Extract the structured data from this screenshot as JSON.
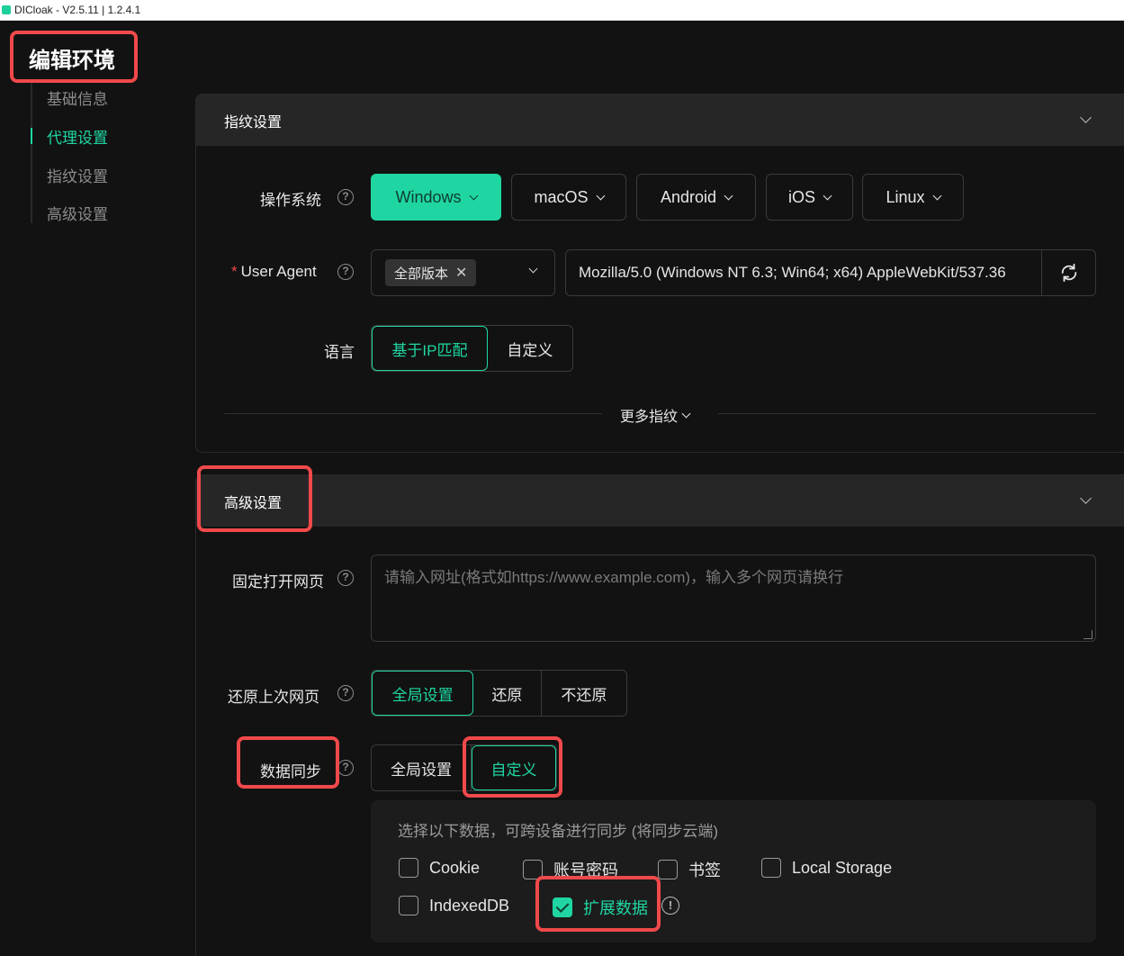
{
  "window": {
    "title": "DICloak - V2.5.11 | 1.2.4.1"
  },
  "page": {
    "title": "编辑环境"
  },
  "sidebar": {
    "items": [
      {
        "label": "基础信息"
      },
      {
        "label": "代理设置"
      },
      {
        "label": "指纹设置"
      },
      {
        "label": "高级设置"
      }
    ],
    "active_index": 1
  },
  "fingerprint": {
    "title": "指纹设置",
    "os_label": "操作系统",
    "os_options": [
      "Windows",
      "macOS",
      "Android",
      "iOS",
      "Linux"
    ],
    "os_selected": "Windows",
    "ua_label": "User Agent",
    "ua_required_mark": "*",
    "ua_version_tag": "全部版本",
    "ua_value": "Mozilla/5.0 (Windows NT 6.3; Win64; x64) AppleWebKit/537.36",
    "language_label": "语言",
    "language_options": [
      "基于IP匹配",
      "自定义"
    ],
    "language_selected": "基于IP匹配",
    "more_link": "更多指纹"
  },
  "advanced": {
    "title": "高级设置",
    "fixed_page_label": "固定打开网页",
    "fixed_page_placeholder": "请输入网址(格式如https://www.example.com)，输入多个网页请换行",
    "restore_label": "还原上次网页",
    "restore_options": [
      "全局设置",
      "还原",
      "不还原"
    ],
    "restore_selected": "全局设置",
    "sync_label": "数据同步",
    "sync_options": [
      "全局设置",
      "自定义"
    ],
    "sync_selected": "自定义",
    "sync_description": "选择以下数据，可跨设备进行同步 (将同步云端)",
    "sync_items": [
      {
        "label": "Cookie",
        "checked": false
      },
      {
        "label": "账号密码",
        "checked": false
      },
      {
        "label": "书签",
        "checked": false
      },
      {
        "label": "Local Storage",
        "checked": false
      },
      {
        "label": "IndexedDB",
        "checked": false
      },
      {
        "label": "扩展数据",
        "checked": true
      }
    ]
  },
  "colors": {
    "accent": "#1fd6a2",
    "highlight": "#f0494b",
    "background": "#121212",
    "panel_header": "#262626"
  },
  "icons": {
    "help": "question-circle-icon",
    "refresh": "refresh-icon",
    "info": "exclamation-circle-icon",
    "collapse": "chevron-down-icon",
    "remove_tag": "close-icon"
  }
}
